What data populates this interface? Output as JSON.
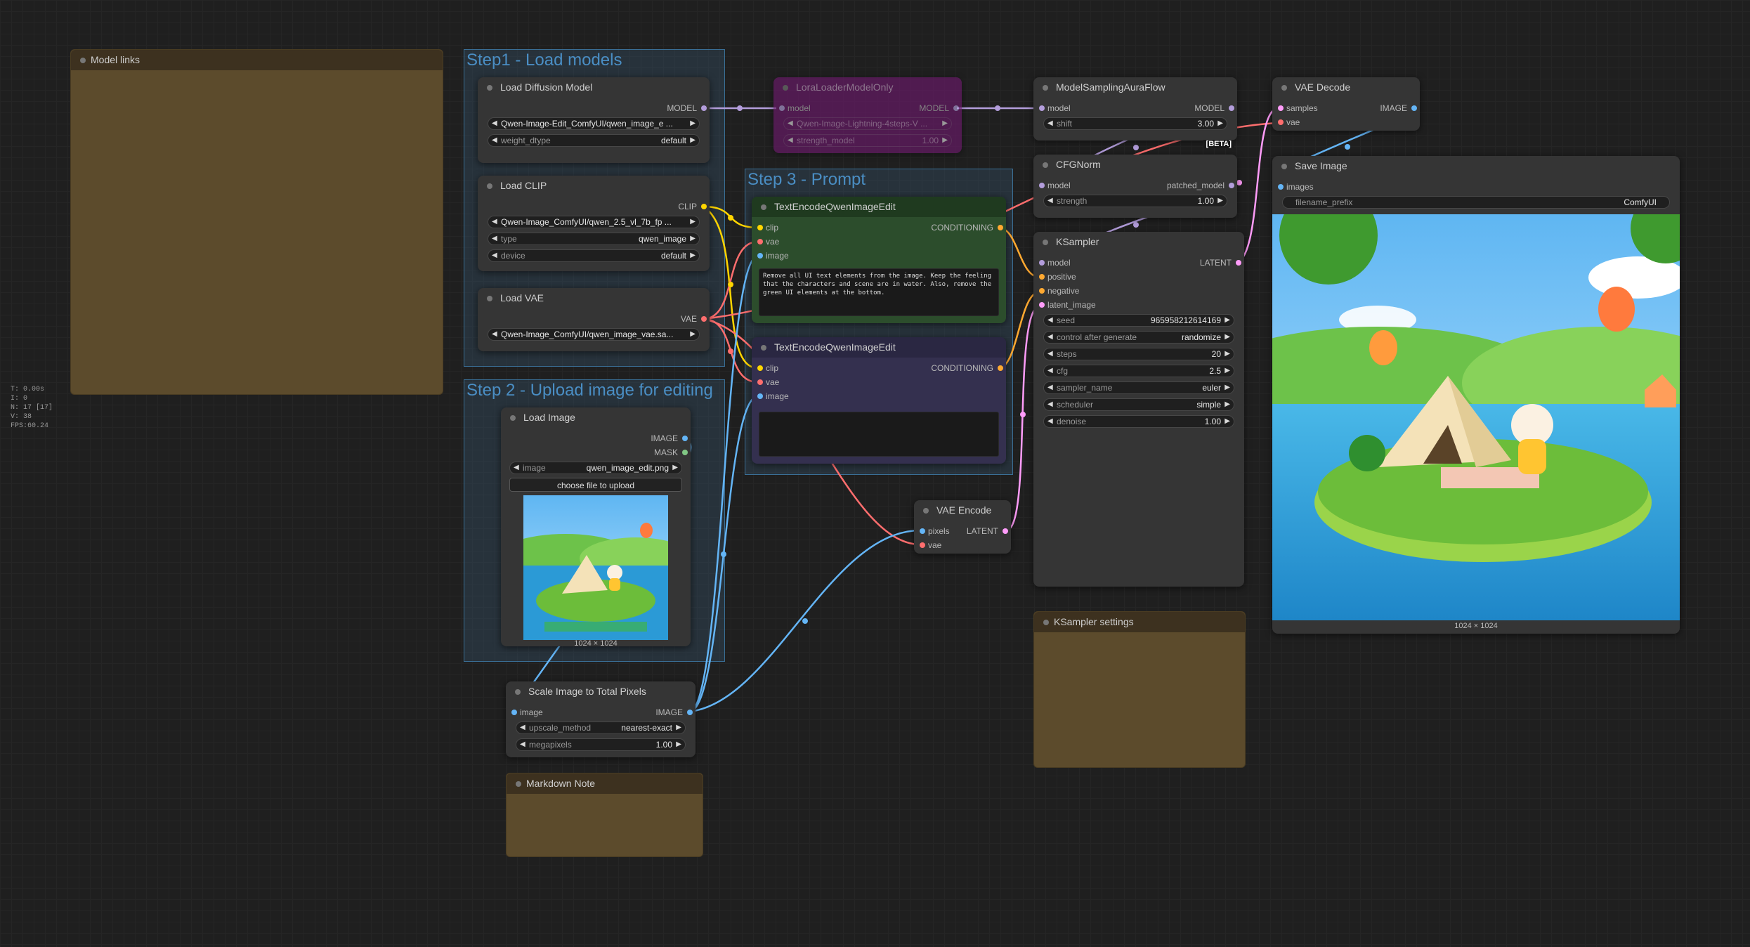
{
  "stats": [
    "T: 0.00s",
    "I: 0",
    "N: 17 [17]",
    "V: 38",
    "FPS:60.24"
  ],
  "groups": {
    "step1": "Step1 - Load models",
    "step2": "Step 2 - Upload image for editing",
    "step3": "Step 3 - Prompt"
  },
  "notes": {
    "model_links": "Model links",
    "markdown": "Markdown Note",
    "ksampler_settings": "KSampler settings"
  },
  "nodes": {
    "load_diffusion": {
      "title": "Load Diffusion Model",
      "out_model": "MODEL",
      "unet_name": "Qwen-Image-Edit_ComfyUI/qwen_image_e ...",
      "weight_dtype_label": "weight_dtype",
      "weight_dtype": "default"
    },
    "load_clip": {
      "title": "Load CLIP",
      "out_clip": "CLIP",
      "clip_name": "Qwen-Image_ComfyUI/qwen_2.5_vl_7b_fp ...",
      "type_label": "type",
      "type": "qwen_image",
      "device_label": "device",
      "device": "default"
    },
    "load_vae": {
      "title": "Load VAE",
      "out_vae": "VAE",
      "vae_name": "Qwen-Image_ComfyUI/qwen_image_vae.sa..."
    },
    "lora": {
      "title": "LoraLoaderModelOnly",
      "in_model": "model",
      "out_model": "MODEL",
      "lora_name": "Qwen-Image-Lightning-4steps-V ...",
      "strength_label": "strength_model",
      "strength": "1.00"
    },
    "model_sampling": {
      "title": "ModelSamplingAuraFlow",
      "in_model": "model",
      "out_model": "MODEL",
      "shift_label": "shift",
      "shift": "3.00",
      "beta": "[BETA]"
    },
    "cfg_norm": {
      "title": "CFGNorm",
      "in_model": "model",
      "out_model": "patched_model",
      "strength_label": "strength",
      "strength": "1.00"
    },
    "ksampler": {
      "title": "KSampler",
      "in_model": "model",
      "in_positive": "positive",
      "in_negative": "negative",
      "in_latent": "latent_image",
      "out_latent": "LATENT",
      "widgets": [
        {
          "label": "seed",
          "value": "965958212614169"
        },
        {
          "label": "control after generate",
          "value": "randomize"
        },
        {
          "label": "steps",
          "value": "20"
        },
        {
          "label": "cfg",
          "value": "2.5"
        },
        {
          "label": "sampler_name",
          "value": "euler"
        },
        {
          "label": "scheduler",
          "value": "simple"
        },
        {
          "label": "denoise",
          "value": "1.00"
        }
      ]
    },
    "vae_decode": {
      "title": "VAE Decode",
      "in_samples": "samples",
      "in_vae": "vae",
      "out_image": "IMAGE"
    },
    "save_image": {
      "title": "Save Image",
      "in_images": "images",
      "prefix_label": "filename_prefix",
      "prefix": "ComfyUI",
      "dims": "1024 × 1024"
    },
    "text_encode_pos": {
      "title": "TextEncodeQwenImageEdit",
      "in_clip": "clip",
      "in_vae": "vae",
      "in_image": "image",
      "out_cond": "CONDITIONING",
      "prompt": "Remove all UI text elements from the image. Keep the feeling that the characters and scene are in water. Also, remove the green UI elements at the bottom."
    },
    "text_encode_neg": {
      "title": "TextEncodeQwenImageEdit",
      "in_clip": "clip",
      "in_vae": "vae",
      "in_image": "image",
      "out_cond": "CONDITIONING",
      "prompt": ""
    },
    "load_image": {
      "title": "Load Image",
      "out_image": "IMAGE",
      "out_mask": "MASK",
      "image_label": "image",
      "image": "qwen_image_edit.png",
      "upload": "choose file to upload",
      "dims": "1024 × 1024"
    },
    "vae_encode": {
      "title": "VAE Encode",
      "in_pixels": "pixels",
      "in_vae": "vae",
      "out_latent": "LATENT"
    },
    "scale_image": {
      "title": "Scale Image to Total Pixels",
      "in_image": "image",
      "out_image": "IMAGE",
      "upscale_label": "upscale_method",
      "upscale": "nearest-exact",
      "megapixels_label": "megapixels",
      "megapixels": "1.00"
    }
  },
  "colors": {
    "model": "#b39ddb",
    "clip": "#ffd500",
    "vae": "#ff6e6e",
    "image": "#64b5f6",
    "conditioning": "#ffa931",
    "latent": "#ff9cf9",
    "mask": "#81c784"
  }
}
